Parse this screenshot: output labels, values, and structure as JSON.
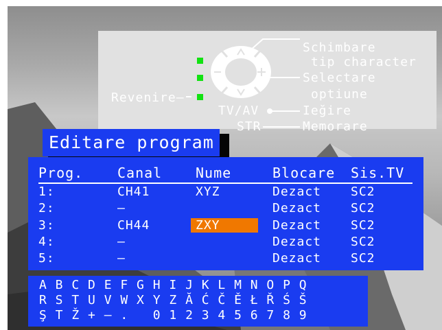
{
  "help": {
    "change_char_type_line1": "Schimbare",
    "change_char_type_line2": "tip character",
    "select_option_line1": "Selectare",
    "select_option_line2": "optiune",
    "back_label": "Revenire",
    "tvav_label": "TV/AV",
    "exit_label": "Ieğire",
    "str_label": "STR",
    "memorize_label": "Memorare",
    "led_color": "#12e212"
  },
  "title": "Editare program",
  "table": {
    "headers": [
      "Prog.",
      "Canal",
      "Nume",
      "Blocare",
      "Sis.TV"
    ],
    "rows": [
      {
        "prog": "1:",
        "canal": "CH41",
        "nume": "XYZ",
        "blocare": "Dezact",
        "sistv": "SC2"
      },
      {
        "prog": "2:",
        "canal": "–",
        "nume": "",
        "blocare": "Dezact",
        "sistv": "SC2"
      },
      {
        "prog": "3:",
        "canal": "CH44",
        "nume": "ZXY",
        "blocare": "Dezact",
        "sistv": "SC2"
      },
      {
        "prog": "4:",
        "canal": "–",
        "nume": "",
        "blocare": "Dezact",
        "sistv": "SC2"
      },
      {
        "prog": "5:",
        "canal": "–",
        "nume": "",
        "blocare": "Dezact",
        "sistv": "SC2"
      }
    ],
    "selected_row": 3,
    "highlight_color": "#f07800"
  },
  "chars": {
    "row1": "A B C D E F G H I J K L M N O P Q",
    "row2": "R S T U V W X Y Z Ă Ć Č Ě Ł Ř Ś Š",
    "row3": "Ş T Ž + – .   0 1 2 3 4 5 6 7 8 9"
  },
  "colors": {
    "panel_blue": "#1a3cf0",
    "help_bg": "#e1e1e1"
  }
}
